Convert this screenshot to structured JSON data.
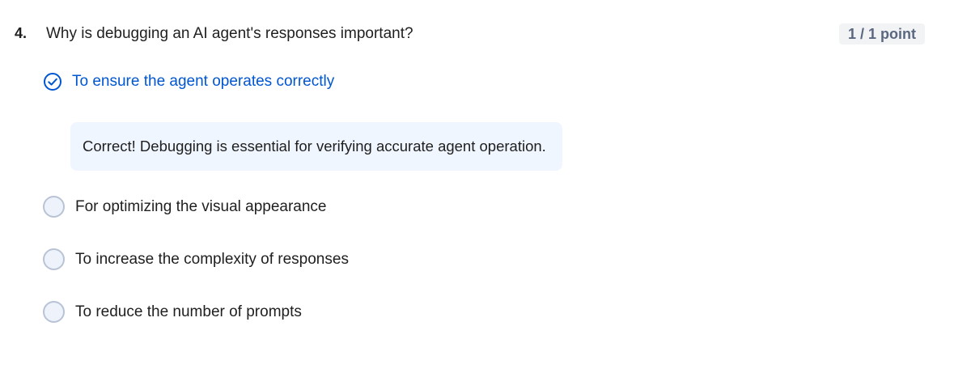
{
  "question": {
    "number": "4.",
    "text": "Why is debugging an AI agent's responses important?",
    "score": "1 / 1 point"
  },
  "selected_option": {
    "label": "To ensure the agent operates correctly",
    "icon": "check-circle-icon",
    "state": "correct"
  },
  "feedback": {
    "text": "Correct! Debugging is essential for verifying accurate agent operation."
  },
  "other_options": [
    {
      "label": "For optimizing the visual appearance",
      "icon": "radio-unselected-icon"
    },
    {
      "label": "To increase the complexity of responses",
      "icon": "radio-unselected-icon"
    },
    {
      "label": "To reduce the number of prompts",
      "icon": "radio-unselected-icon"
    }
  ],
  "colors": {
    "correct_accent": "#0056d2",
    "feedback_background": "#f0f6ff",
    "score_badge_background": "#f1f3f5",
    "score_badge_text": "#5b6780",
    "radio_border": "#b9c3d6",
    "radio_fill": "#eef2fa"
  }
}
